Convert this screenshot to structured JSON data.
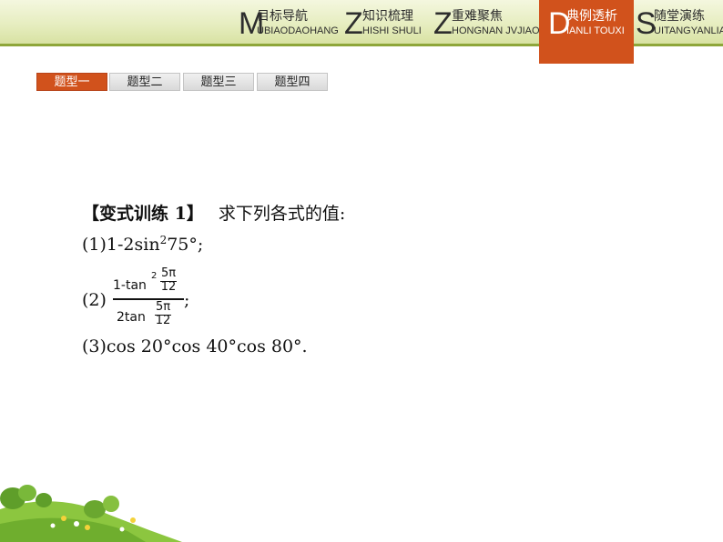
{
  "nav": {
    "items": [
      {
        "letter": "M",
        "cn": "目标导航",
        "en": "UBIAODAOHANG"
      },
      {
        "letter": "Z",
        "cn": "知识梳理",
        "en": "HISHI SHULI"
      },
      {
        "letter": "Z",
        "cn": "重难聚焦",
        "en": "HONGNAN JVJIAO"
      },
      {
        "letter": "D",
        "cn": "典例透析",
        "en": "IANLI TOUXI"
      },
      {
        "letter": "S",
        "cn": "随堂演练",
        "en": "UITANGYANLIAN"
      }
    ],
    "active_index": 3,
    "active_color": "#d1521c"
  },
  "tabs": [
    "题型一",
    "题型二",
    "题型三",
    "题型四"
  ],
  "exercise": {
    "heading_bold": "【变式训练 1】",
    "heading_text": "求下列各式的值:",
    "item1_prefix": "(1)1-2sin",
    "item1_sup": "2",
    "item1_suffix": "75°;",
    "item2_prefix": "(2)",
    "item2_num_text": "1-tan",
    "item2_num_sup": "2",
    "item2_den_text": "2tan",
    "item2_small_num": "5π",
    "item2_small_den": "12",
    "item2_suffix": ";",
    "item3": "(3)cos 20°cos 40°cos 80°."
  }
}
